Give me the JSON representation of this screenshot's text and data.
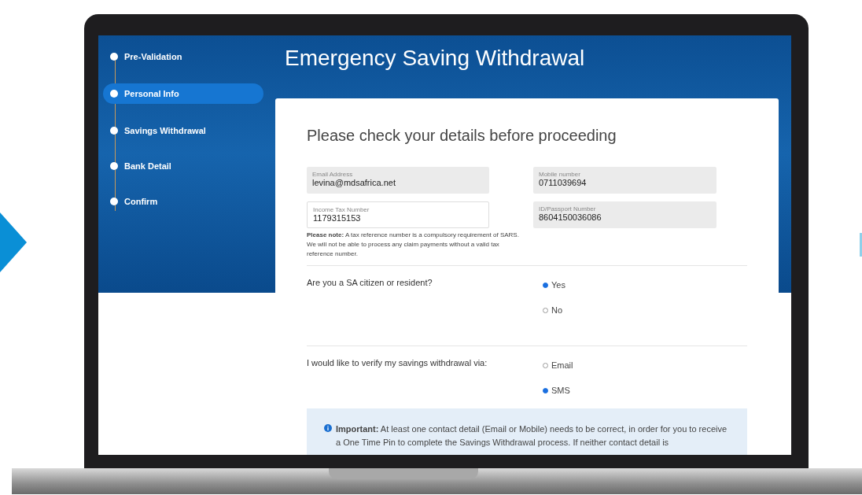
{
  "steps": [
    {
      "label": "Pre-Validation",
      "selected": false
    },
    {
      "label": "Personal Info",
      "selected": true
    },
    {
      "label": "Savings Withdrawal",
      "selected": false
    },
    {
      "label": "Bank Detail",
      "selected": false
    },
    {
      "label": "Confirm",
      "selected": false
    }
  ],
  "page_title": "Emergency Saving Withdrawal",
  "card": {
    "heading": "Please check your details before proceeding",
    "fields": [
      {
        "label": "Email Address",
        "value": "levina@mdsafrica.net",
        "kind": "readonly"
      },
      {
        "label": "Mobile number",
        "value": "0711039694",
        "kind": "readonly"
      },
      {
        "label": "Income Tax Number",
        "value": "1179315153",
        "kind": "editable"
      },
      {
        "label": "ID/Passport Number",
        "value": "8604150036086",
        "kind": "readonly"
      }
    ],
    "note": "**Please note:** A tax reference number is a compulsory requirement of SARS. We will not be able to process any claim payments without a valid tax reference number.",
    "questions": [
      {
        "label": "Are you a SA citizen or resident?",
        "options": [
          {
            "label": "Yes",
            "selected": true
          },
          {
            "label": "No",
            "selected": false
          }
        ]
      },
      {
        "label": "I would like to verify my savings withdrawal via:",
        "options": [
          {
            "label": "Email",
            "selected": false
          },
          {
            "label": "SMS",
            "selected": true
          }
        ]
      }
    ],
    "important": "**Important:** At least one contact detail (Email or Mobile) needs to be correct, in order for you to receive a One Time Pin to complete the Savings Withdrawal process. If neither contact detail is"
  }
}
